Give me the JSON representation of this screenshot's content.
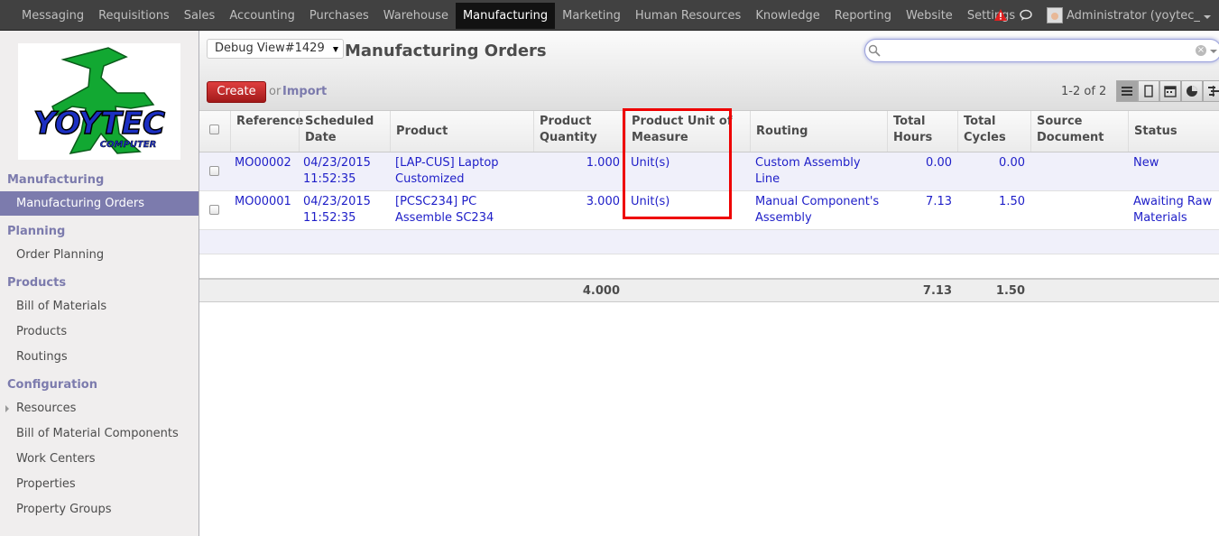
{
  "topnav": {
    "items": [
      "Messaging",
      "Requisitions",
      "Sales",
      "Accounting",
      "Purchases",
      "Warehouse",
      "Manufacturing",
      "Marketing",
      "Human Resources",
      "Knowledge",
      "Reporting",
      "Website",
      "Settings"
    ],
    "active": "Manufacturing",
    "user": "Administrator (yoytec_d...",
    "icons": [
      "alert-icon",
      "chat-icon",
      "avatar",
      "chevron-down-icon"
    ]
  },
  "sidebar": {
    "logo_text": "YOYTEC COMPUTER",
    "sections": [
      {
        "title": "Manufacturing",
        "items": [
          "Manufacturing Orders"
        ]
      },
      {
        "title": "Planning",
        "items": [
          "Order Planning"
        ]
      },
      {
        "title": "Products",
        "items": [
          "Bill of Materials",
          "Products",
          "Routings"
        ]
      },
      {
        "title": "Configuration",
        "items": [
          "Resources",
          "Bill of Material Components",
          "Work Centers",
          "Properties",
          "Property Groups"
        ]
      }
    ],
    "active_item": "Manufacturing Orders"
  },
  "header": {
    "debug_select": "Debug View#1429",
    "title": "Manufacturing Orders",
    "search_value": "",
    "create_label": "Create",
    "or_label": "or",
    "import_label": "Import",
    "pager": "1-2 of 2",
    "view_icons": [
      "list-view-icon",
      "form-view-icon",
      "calendar-view-icon",
      "graph-view-icon",
      "gantt-view-icon"
    ]
  },
  "table": {
    "columns": [
      "Reference",
      "Scheduled Date",
      "Product",
      "Product Quantity",
      "Product Unit of Measure",
      "Routing",
      "Total Hours",
      "Total Cycles",
      "Source Document",
      "Status"
    ],
    "rows": [
      {
        "reference": "MO00002",
        "date": "04/23/2015 11:52:35",
        "product": "[LAP-CUS] Laptop Customized",
        "quantity": "1.000",
        "uom": "Unit(s)",
        "routing": "Custom Assembly Line",
        "hours": "0.00",
        "cycles": "0.00",
        "source": "",
        "status": "New"
      },
      {
        "reference": "MO00001",
        "date": "04/23/2015 11:52:35",
        "product": "[PCSC234] PC Assemble SC234",
        "quantity": "3.000",
        "uom": "Unit(s)",
        "routing": "Manual Component's Assembly",
        "hours": "7.13",
        "cycles": "1.50",
        "source": "",
        "status": "Awaiting Raw Materials"
      }
    ],
    "totals": {
      "quantity": "4.000",
      "hours": "7.13",
      "cycles": "1.50"
    }
  },
  "colors": {
    "topbar": "#414141",
    "accent": "#7c7bad",
    "link": "#1e1ec8",
    "create": "#c02020",
    "highlight": "#ee0000"
  }
}
